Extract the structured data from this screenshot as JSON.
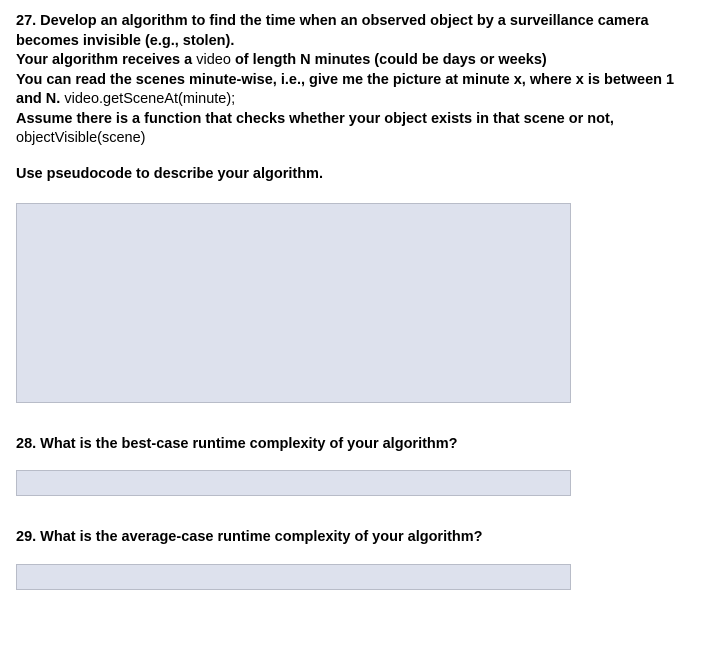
{
  "q27": {
    "line1": "27. Develop an algorithm to find the time when an observed object by a surveillance camera becomes invisible (e.g., stolen).",
    "line2a": "Your algorithm receives a ",
    "line2b": "video",
    "line2c": " of length N minutes (could be days or weeks)",
    "line3a": "You can read the scenes minute-wise, i.e., give me the picture at minute x, where x is between 1 and N. ",
    "line3b": "video.getSceneAt(minute);",
    "line4a": "Assume there is a function that checks whether your object exists in that scene or not, ",
    "line4b": "objectVisible(scene)",
    "instruction": "Use pseudocode to describe your algorithm."
  },
  "q28": {
    "text": "28. What is the best-case runtime complexity of your algorithm?"
  },
  "q29": {
    "text": "29. What is the average-case runtime complexity of your algorithm?"
  }
}
